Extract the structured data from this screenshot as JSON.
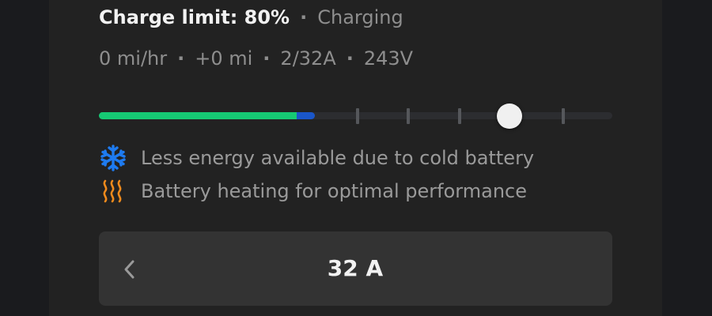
{
  "charge": {
    "limit_label": "Charge limit: 80%",
    "separator": "·",
    "status": "Charging"
  },
  "stats": [
    {
      "label": "0 mi/hr"
    },
    {
      "label": "+0 mi"
    },
    {
      "label": "2/32A"
    },
    {
      "label": "243V"
    }
  ],
  "slider": {
    "charge_level_fraction": 0.42,
    "energy_available_fraction": 0.385,
    "limit_fraction": 0.8,
    "colors": {
      "energy": "#16c974",
      "cold_reserved": "#1a56c9",
      "track": "#2c2d30"
    }
  },
  "notices": [
    {
      "icon": "snowflake-icon",
      "color": "#1e7bf0",
      "text": "Less energy available due to cold battery"
    },
    {
      "icon": "heating-icon",
      "color": "#f08a1c",
      "text": "Battery heating for optimal performance"
    }
  ],
  "amperage": {
    "value": "32 A",
    "decrease_icon": "chevron-left-icon"
  }
}
